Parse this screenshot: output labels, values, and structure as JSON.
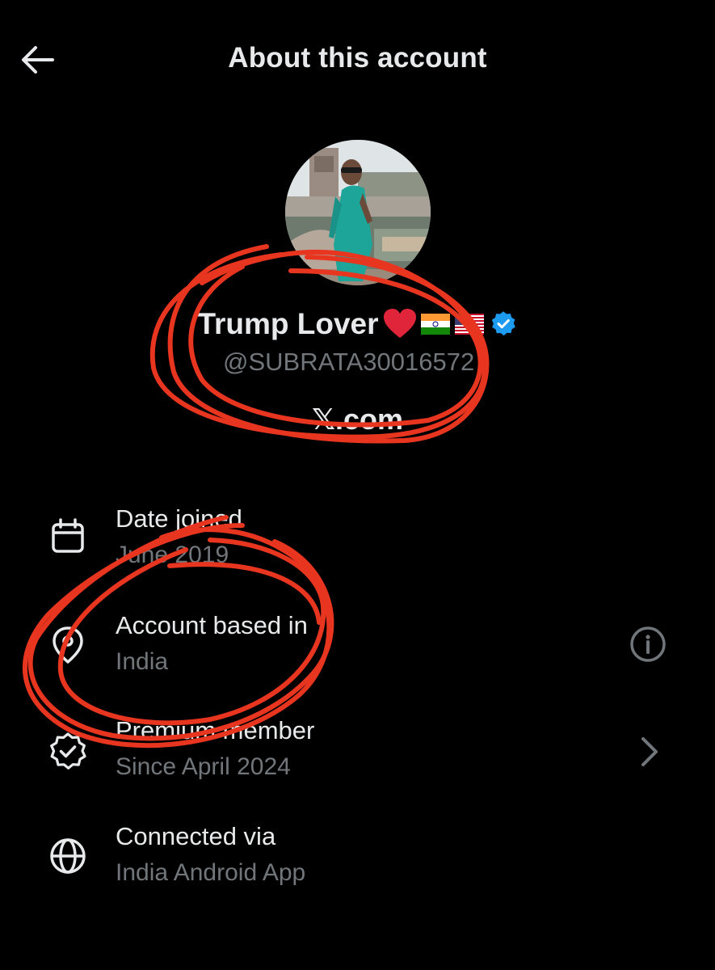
{
  "header": {
    "title": "About this account",
    "back_icon": "arrow-left-icon"
  },
  "profile": {
    "display_name": "Trump Lover",
    "emojis": [
      "❤️",
      "🇮🇳",
      "🇺🇸"
    ],
    "verified": true,
    "handle": "@SUBRATA30016572",
    "source_site": "𝕏.com"
  },
  "info_rows": [
    {
      "icon": "calendar-icon",
      "label": "Date joined",
      "value": "June 2019"
    },
    {
      "icon": "location-pin-icon",
      "label": "Account based in",
      "value": "India",
      "action_icon": "info-circle-icon"
    },
    {
      "icon": "verified-badge-icon",
      "label": "Premium member",
      "value": "Since April 2024",
      "action_icon": "chevron-right-icon"
    },
    {
      "icon": "globe-icon",
      "label": "Connected via",
      "value": "India Android App"
    }
  ],
  "colors": {
    "background": "#000000",
    "primary_text": "#e7e9ea",
    "secondary_text": "#71767b",
    "verified_blue": "#1d9bf0",
    "annotation_red": "#e8351f"
  }
}
